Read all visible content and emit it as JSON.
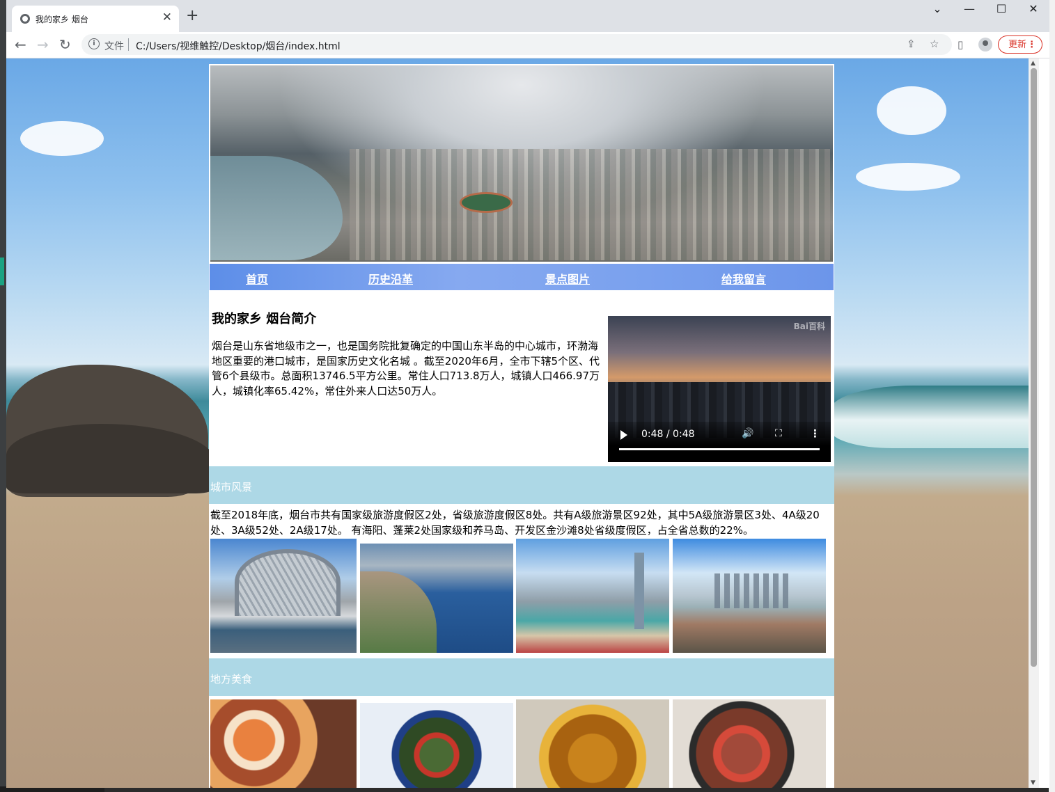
{
  "browser": {
    "tab_title": "我的家乡 烟台",
    "new_tab": "+",
    "close_tab": "✕",
    "window_controls": {
      "minimize": "—",
      "maximize": "☐",
      "close": "✕",
      "tabsearch": "⌄"
    },
    "scheme_label": "文件",
    "url": "C:/Users/视维触控/Desktop/烟台/index.html",
    "update_label": "更新"
  },
  "page": {
    "nav": [
      "首页",
      "历史沿革",
      "景点图片",
      "给我留言"
    ],
    "intro": {
      "title": "我的家乡 烟台简介",
      "text": "烟台是山东省地级市之一，也是国务院批复确定的中国山东半岛的中心城市，环渤海地区重要的港口城市，是国家历史文化名城 。截至2020年6月，全市下辖5个区、代管6个县级市。总面积13746.5平方公里。常住人口713.8万人，城镇人口466.97万人，城镇化率65.42%，常住外来人口达50万人。"
    },
    "video": {
      "time": "0:48 / 0:48",
      "watermark": "Bai百科",
      "progress": 1.0
    },
    "scenery": {
      "title": "城市风景",
      "text": "截至2018年底，烟台市共有国家级旅游度假区2处，省级旅游度假区8处。共有A级旅游景区92处，其中5A级旅游景区3处、4A级20处、3A级52处、2A级17处。 有海阳、蓬莱2处国家级和养马岛、开发区金沙滩8处省级度假区，占全省总数的22%。"
    },
    "food": {
      "title": "地方美食"
    }
  },
  "colors": {
    "section_bar": "#add8e6",
    "nav_bar": "#6c95ea",
    "update_accent": "#d93025"
  }
}
